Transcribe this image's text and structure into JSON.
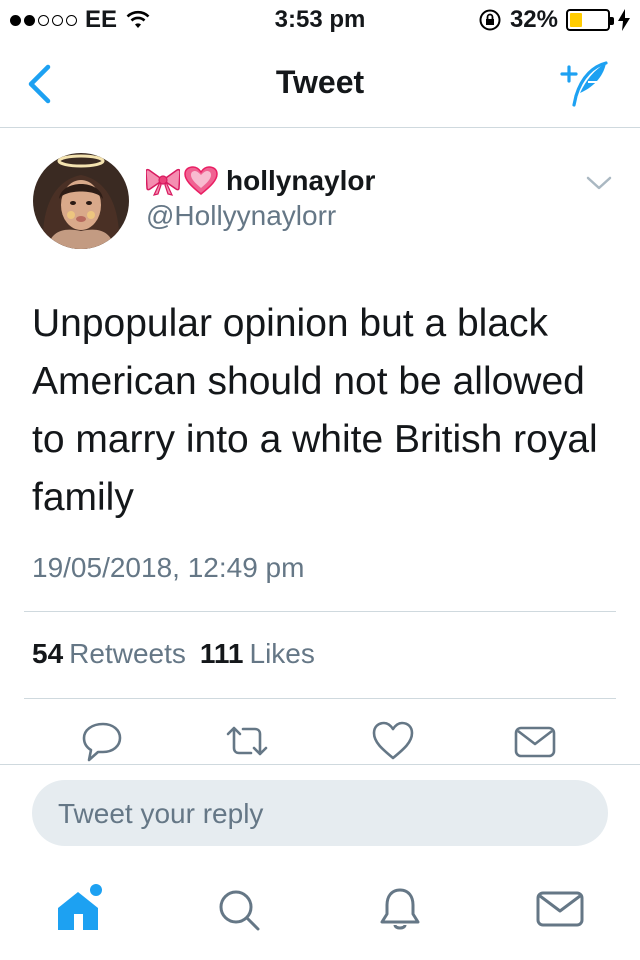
{
  "status_bar": {
    "carrier": "EE",
    "time": "3:53 pm",
    "battery_percent": "32%",
    "battery_level": 0.32,
    "signal_bars_filled": 2,
    "signal_bars_total": 5
  },
  "nav": {
    "title": "Tweet",
    "back_icon": "chevron-left-icon",
    "compose_icon": "compose-tweet-icon"
  },
  "tweet": {
    "emoji_prefix": "ribbon-and-heart-emoji",
    "display_name": "hollynaylor",
    "handle": "@Hollyynaylorr",
    "text": "Unpopular opinion but a black American should not be allowed to marry into a white British royal family",
    "timestamp": "19/05/2018, 12:49 pm",
    "retweets_count": "54",
    "retweets_label": "Retweets",
    "likes_count": "111",
    "likes_label": "Likes"
  },
  "actions": [
    "reply-icon",
    "retweet-icon",
    "like-icon",
    "direct-message-icon"
  ],
  "reply": {
    "placeholder": "Tweet your reply"
  },
  "tab_bar": [
    "home-icon",
    "search-icon",
    "notifications-icon",
    "messages-icon"
  ],
  "colors": {
    "accent": "#1da1f2",
    "secondary_text": "#657786",
    "reply_bg": "#e6ecf0",
    "divider": "#cfd9de",
    "battery": "#ffcc00"
  }
}
